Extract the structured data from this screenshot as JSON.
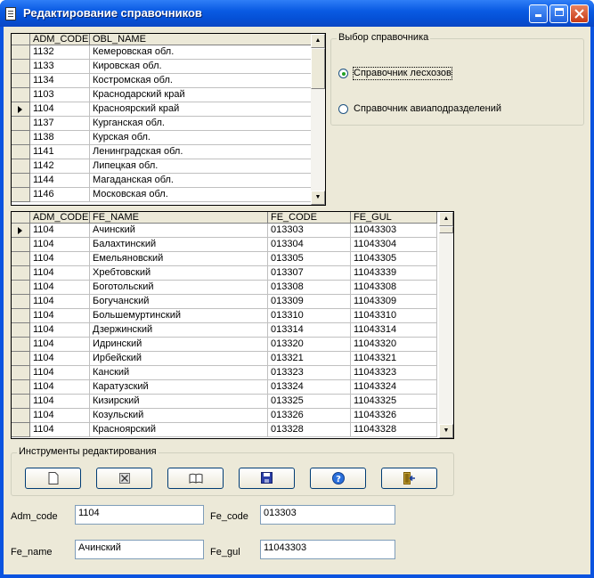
{
  "window": {
    "title": "Редактирование справочников"
  },
  "obl_grid": {
    "columns": [
      "ADM_CODE",
      "OBL_NAME"
    ],
    "current_row": 4,
    "rows": [
      [
        "1132",
        "Кемеровская обл."
      ],
      [
        "1133",
        "Кировская обл."
      ],
      [
        "1134",
        "Костромская обл."
      ],
      [
        "1103",
        "Краснодарский край"
      ],
      [
        "1104",
        "Красноярский край"
      ],
      [
        "1137",
        "Курганская обл."
      ],
      [
        "1138",
        "Курская обл."
      ],
      [
        "1141",
        "Ленинградская обл."
      ],
      [
        "1142",
        "Липецкая обл."
      ],
      [
        "1144",
        "Магаданская обл."
      ],
      [
        "1146",
        "Московская обл."
      ]
    ]
  },
  "choice_group": {
    "title": "Выбор справочника",
    "options": [
      {
        "label": "Справочник лесхозов",
        "selected": true
      },
      {
        "label": "Справочник авиаподразделений",
        "selected": false
      }
    ]
  },
  "fe_grid": {
    "columns": [
      "ADM_CODE",
      "FE_NAME",
      "FE_CODE",
      "FE_GUL"
    ],
    "current_row": 0,
    "rows": [
      [
        "1104",
        "Ачинский",
        "013303",
        "11043303"
      ],
      [
        "1104",
        "Балахтинский",
        "013304",
        "11043304"
      ],
      [
        "1104",
        "Емельяновский",
        "013305",
        "11043305"
      ],
      [
        "1104",
        "Хребтовский",
        "013307",
        "11043339"
      ],
      [
        "1104",
        "Боготольский",
        "013308",
        "11043308"
      ],
      [
        "1104",
        "Богучанский",
        "013309",
        "11043309"
      ],
      [
        "1104",
        "Большемуртинский",
        "013310",
        "11043310"
      ],
      [
        "1104",
        "Дзержинский",
        "013314",
        "11043314"
      ],
      [
        "1104",
        "Идринский",
        "013320",
        "11043320"
      ],
      [
        "1104",
        "Ирбейский",
        "013321",
        "11043321"
      ],
      [
        "1104",
        "Канский",
        "013323",
        "11043323"
      ],
      [
        "1104",
        "Каратузский",
        "013324",
        "11043324"
      ],
      [
        "1104",
        "Кизирский",
        "013325",
        "11043325"
      ],
      [
        "1104",
        "Козульский",
        "013326",
        "11043326"
      ],
      [
        "1104",
        "Красноярский",
        "013328",
        "11043328"
      ]
    ]
  },
  "tools_group": {
    "title": "Инструменты редактирования",
    "buttons": [
      "new-document-icon",
      "delete-icon",
      "open-book-icon",
      "save-disk-icon",
      "help-icon",
      "exit-door-icon"
    ]
  },
  "form": {
    "adm_code_label": "Adm_code",
    "adm_code_value": "1104",
    "fe_code_label": "Fe_code",
    "fe_code_value": "013303",
    "fe_name_label": "Fe_name",
    "fe_name_value": "Ачинский",
    "fe_gul_label": "Fe_gul",
    "fe_gul_value": "11043303"
  },
  "colors": {
    "titlebar": "#0a5be3",
    "face": "#ece9d8",
    "grid_border": "#000000"
  }
}
